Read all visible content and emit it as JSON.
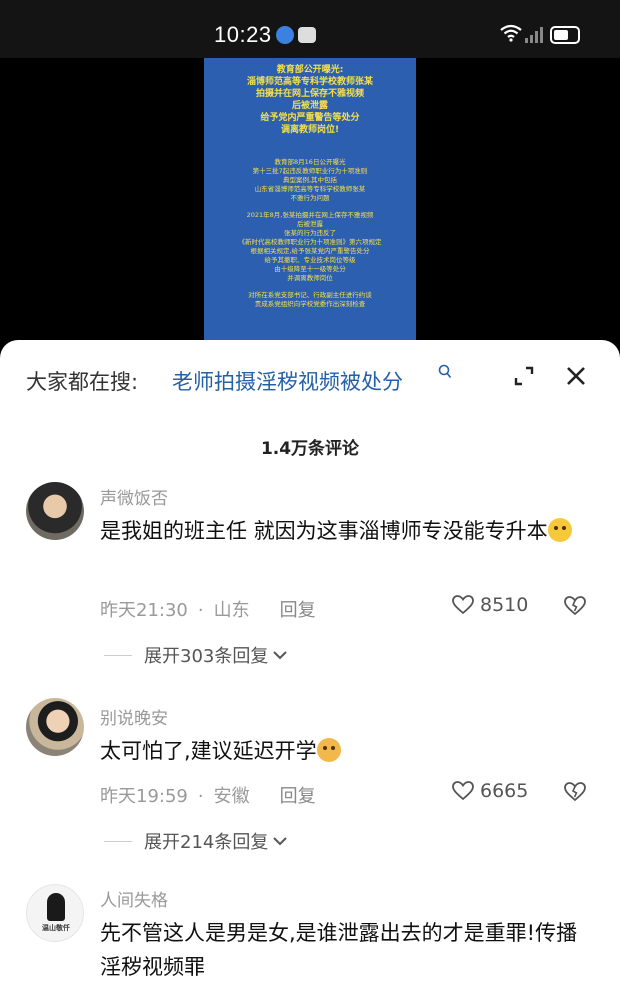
{
  "status_bar": {
    "time": "10:23"
  },
  "video": {
    "poster_lines": [
      "教育部公开曝光:",
      "淄博师范高等专科学校教师张某",
      "拍摄并在网上保存不雅视频",
      "后被泄露",
      "给予党内严重警告等处分",
      "调离教师岗位!"
    ],
    "poster_small": [
      "教育部8月16日公开曝光",
      "第十三批7起违反教师职业行为十项准则",
      "典型案例,其中包括",
      "山东省淄博师范高等专科学校教师张某",
      "不雅行为问题",
      "2021年8月,张某拍摄并在网上保存不雅视频",
      "后被泄露",
      "张某的行为违反了",
      "《新时代高校教师职业行为十项准则》第六项规定",
      "根据相关规定,给予张某党内严重警告处分",
      "给予其撤职、专业技术岗位等级",
      "由十级降至十一级等处分",
      "并调离教师岗位",
      "对所在系党支部书记、行政副主任进行约谈",
      "责成系党组织向学校党委作出深刻检查"
    ]
  },
  "search": {
    "prefix": "大家都在搜:",
    "query": "老师拍摄淫秽视频被处分"
  },
  "comment_count": "1.4万条评论",
  "comments": [
    {
      "user": "声微饭否",
      "text": "是我姐的班主任 就因为这事淄博师专没能专升本",
      "time": "昨天21:30",
      "location": "山东",
      "reply_label": "回复",
      "likes": "8510",
      "expand": "展开303条回复"
    },
    {
      "user": "别说晚安",
      "text": "太可怕了,建议延迟开学",
      "time": "昨天19:59",
      "location": "安徽",
      "reply_label": "回复",
      "likes": "6665",
      "expand": "展开214条回复"
    },
    {
      "user": "人间失格",
      "text": "先不管这人是男是女,是谁泄露出去的才是重罪!传播淫秽视频罪",
      "avatar_text": "温山敬仟"
    }
  ]
}
